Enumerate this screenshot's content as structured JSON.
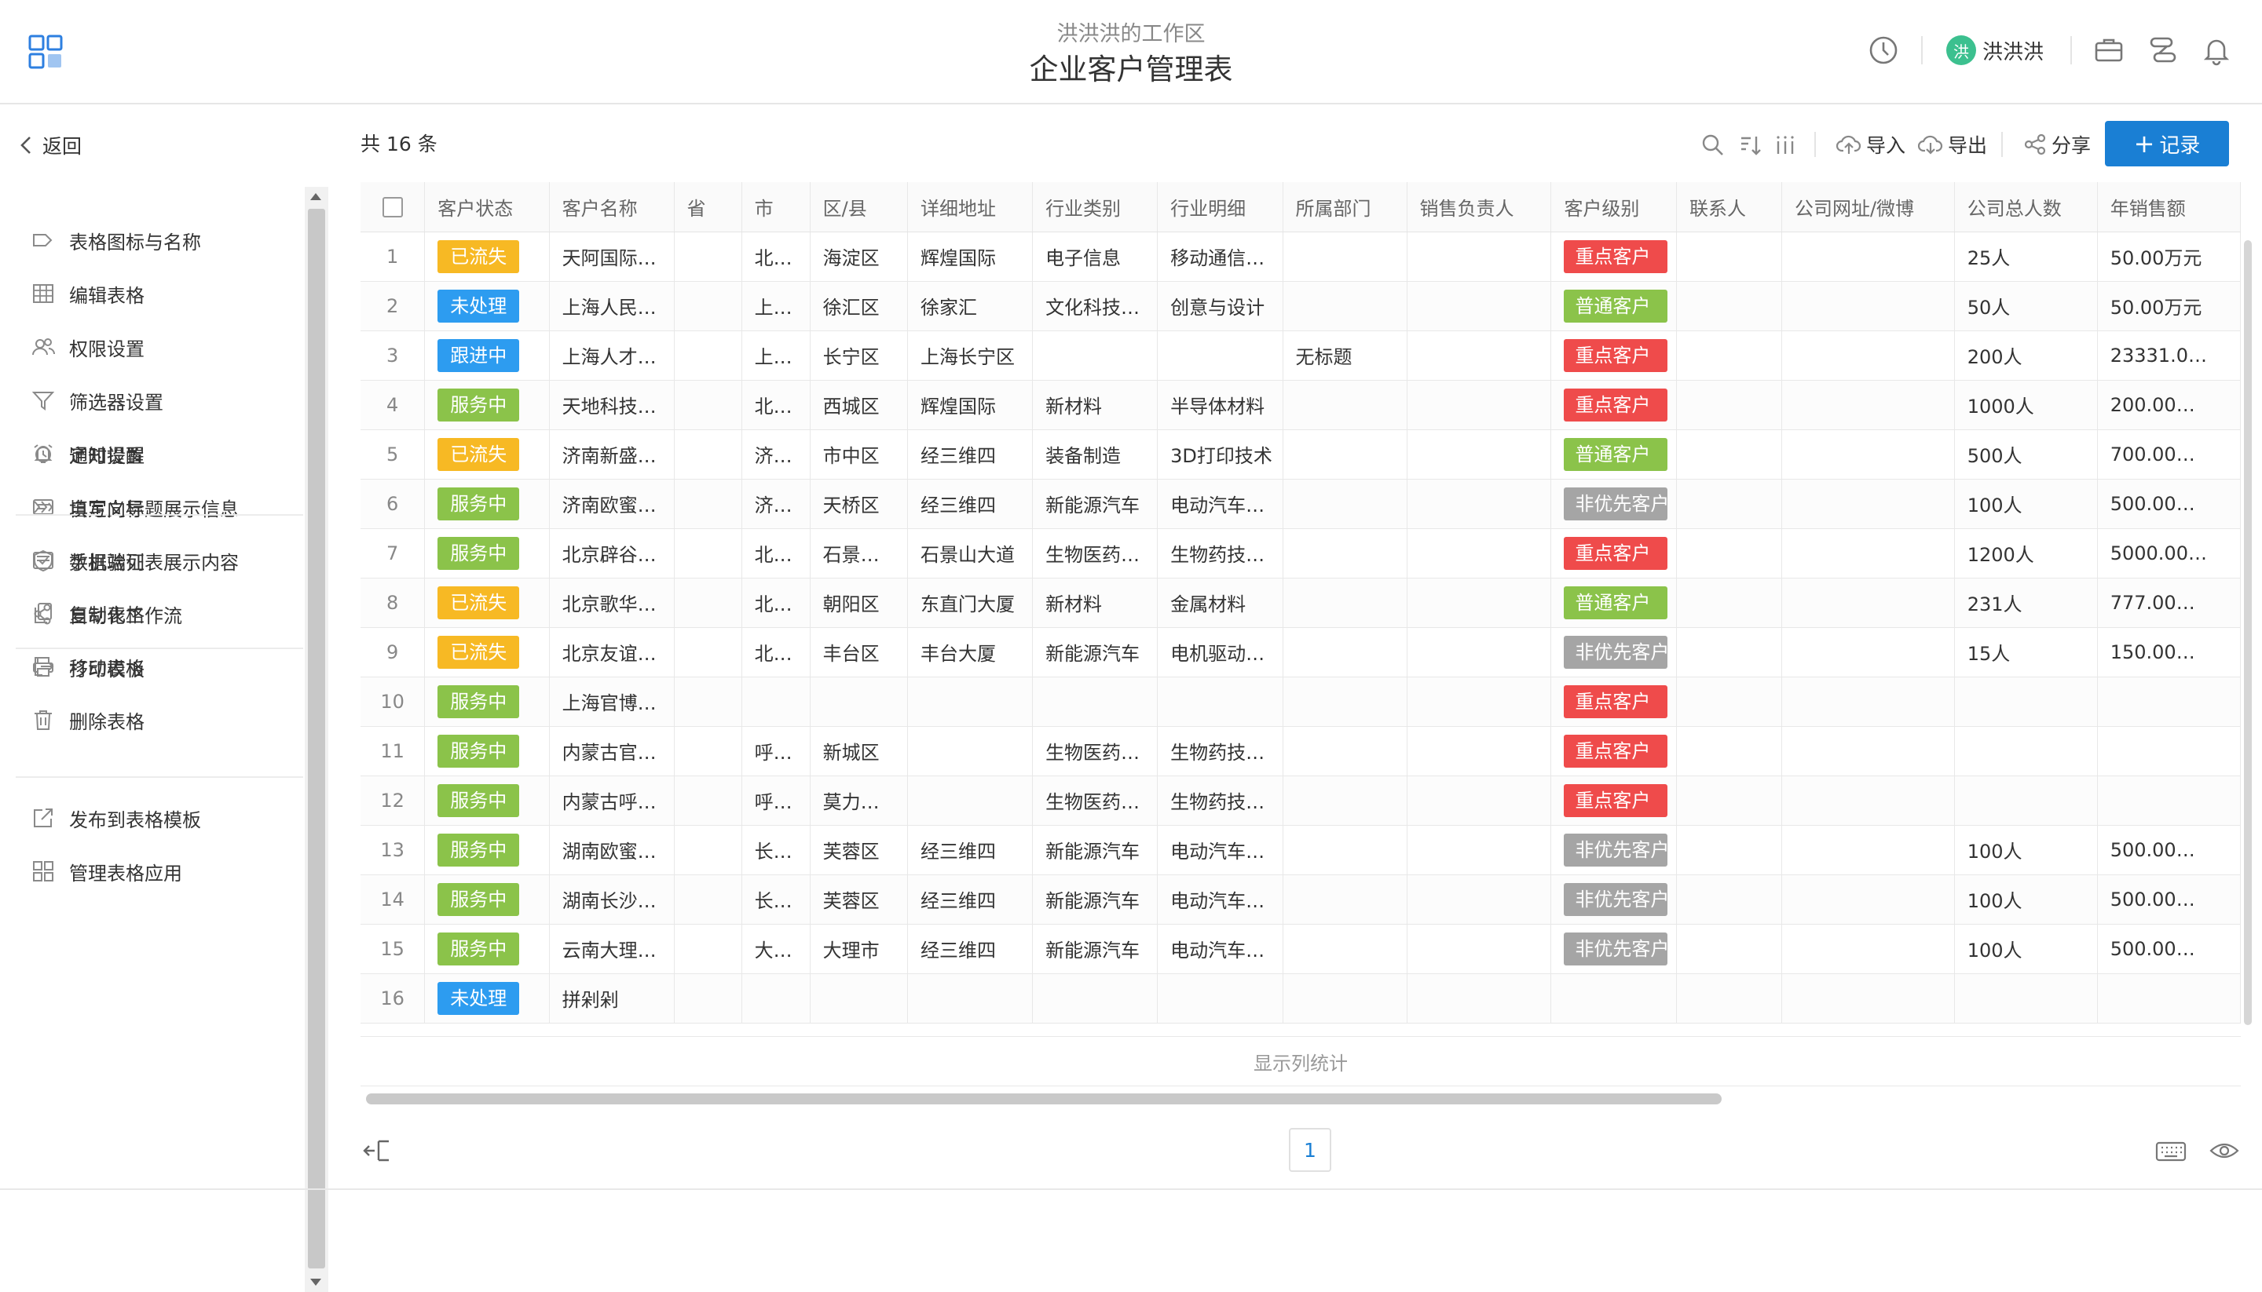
{
  "header": {
    "workspace": "洪洪洪的工作区",
    "title": "企业客户管理表",
    "user_avatar_char": "洪",
    "user_name": "洪洪洪"
  },
  "sidebar": {
    "back_label": "返回",
    "groups": [
      [
        {
          "label": "表格图标与名称",
          "icon": "tag-icon"
        },
        {
          "label": "编辑表格",
          "icon": "table-icon"
        },
        {
          "label": "权限设置",
          "icon": "users-icon"
        },
        {
          "label": "筛选器设置",
          "icon": "filter-icon"
        },
        {
          "label": "通知设置",
          "icon": "bell-icon"
        },
        {
          "label": "自定义标题展示信息",
          "icon": "title-card-icon"
        },
        {
          "label": "手机端列表展示内容",
          "icon": "mobile-list-icon"
        }
      ],
      [
        {
          "label": "定时提醒",
          "icon": "alarm-icon"
        },
        {
          "label": "填写向导",
          "icon": "guide-icon"
        },
        {
          "label": "数据验证",
          "icon": "shield-check-icon"
        },
        {
          "label": "自动化工作流",
          "icon": "workflow-icon"
        },
        {
          "label": "打印模板",
          "icon": "printer-icon"
        }
      ],
      [
        {
          "label": "复制表格",
          "icon": "copy-icon"
        },
        {
          "label": "移动表格",
          "icon": "move-icon"
        },
        {
          "label": "删除表格",
          "icon": "trash-icon"
        }
      ],
      [
        {
          "label": "发布到表格模板",
          "icon": "publish-icon"
        },
        {
          "label": "管理表格应用",
          "icon": "apps-icon"
        }
      ]
    ]
  },
  "toolbar": {
    "record_count": "共 16 条",
    "import_label": "导入",
    "export_label": "导出",
    "share_label": "分享",
    "add_label": "记录"
  },
  "table": {
    "columns": [
      "客户状态",
      "客户名称",
      "省",
      "市",
      "区/县",
      "详细地址",
      "行业类别",
      "行业明细",
      "所属部门",
      "销售负责人",
      "客户级别",
      "联系人",
      "公司网址/微博",
      "公司总人数",
      "年销售额"
    ],
    "rows": [
      {
        "n": "1",
        "status": "已流失",
        "name": "天阿国际…",
        "prov": "",
        "city": "北…",
        "dist": "海淀区",
        "addr": "辉煌国际",
        "ind": "电子信息",
        "detail": "移动通信…",
        "dept": "",
        "sales": "",
        "level": "重点客户",
        "contact": "",
        "web": "",
        "staff": "25人",
        "revenue": "50.00万元"
      },
      {
        "n": "2",
        "status": "未处理",
        "name": "上海人民…",
        "prov": "",
        "city": "上…",
        "dist": "徐汇区",
        "addr": "徐家汇",
        "ind": "文化科技…",
        "detail": "创意与设计",
        "dept": "",
        "sales": "",
        "level": "普通客户",
        "contact": "",
        "web": "",
        "staff": "50人",
        "revenue": "50.00万元"
      },
      {
        "n": "3",
        "status": "跟进中",
        "name": "上海人才…",
        "prov": "",
        "city": "上…",
        "dist": "长宁区",
        "addr": "上海长宁区",
        "ind": "",
        "detail": "",
        "dept": "无标题",
        "sales": "",
        "level": "重点客户",
        "contact": "",
        "web": "",
        "staff": "200人",
        "revenue": "23331.0…"
      },
      {
        "n": "4",
        "status": "服务中",
        "name": "天地科技…",
        "prov": "",
        "city": "北…",
        "dist": "西城区",
        "addr": "辉煌国际",
        "ind": "新材料",
        "detail": "半导体材料",
        "dept": "",
        "sales": "",
        "level": "重点客户",
        "contact": "",
        "web": "",
        "staff": "1000人",
        "revenue": "200.00…"
      },
      {
        "n": "5",
        "status": "已流失",
        "name": "济南新盛…",
        "prov": "",
        "city": "济…",
        "dist": "市中区",
        "addr": "经三维四",
        "ind": "装备制造",
        "detail": "3D打印技术",
        "dept": "",
        "sales": "",
        "level": "普通客户",
        "contact": "",
        "web": "",
        "staff": "500人",
        "revenue": "700.00…"
      },
      {
        "n": "6",
        "status": "服务中",
        "name": "济南欧蜜…",
        "prov": "",
        "city": "济…",
        "dist": "天桥区",
        "addr": "经三维四",
        "ind": "新能源汽车",
        "detail": "电动汽车…",
        "dept": "",
        "sales": "",
        "level": "非优先客户",
        "contact": "",
        "web": "",
        "staff": "100人",
        "revenue": "500.00…"
      },
      {
        "n": "7",
        "status": "服务中",
        "name": "北京辟谷…",
        "prov": "",
        "city": "北…",
        "dist": "石景…",
        "addr": "石景山大道",
        "ind": "生物医药…",
        "detail": "生物药技…",
        "dept": "",
        "sales": "",
        "level": "重点客户",
        "contact": "",
        "web": "",
        "staff": "1200人",
        "revenue": "5000.00…"
      },
      {
        "n": "8",
        "status": "已流失",
        "name": "北京歌华…",
        "prov": "",
        "city": "北…",
        "dist": "朝阳区",
        "addr": "东直门大厦",
        "ind": "新材料",
        "detail": "金属材料",
        "dept": "",
        "sales": "",
        "level": "普通客户",
        "contact": "",
        "web": "",
        "staff": "231人",
        "revenue": "777.00…"
      },
      {
        "n": "9",
        "status": "已流失",
        "name": "北京友谊…",
        "prov": "",
        "city": "北…",
        "dist": "丰台区",
        "addr": "丰台大厦",
        "ind": "新能源汽车",
        "detail": "电机驱动…",
        "dept": "",
        "sales": "",
        "level": "非优先客户",
        "contact": "",
        "web": "",
        "staff": "15人",
        "revenue": "150.00…"
      },
      {
        "n": "10",
        "status": "服务中",
        "name": "上海官博…",
        "prov": "",
        "city": "",
        "dist": "",
        "addr": "",
        "ind": "",
        "detail": "",
        "dept": "",
        "sales": "",
        "level": "重点客户",
        "contact": "",
        "web": "",
        "staff": "",
        "revenue": ""
      },
      {
        "n": "11",
        "status": "服务中",
        "name": "内蒙古官…",
        "prov": "",
        "city": "呼…",
        "dist": "新城区",
        "addr": "",
        "ind": "生物医药…",
        "detail": "生物药技…",
        "dept": "",
        "sales": "",
        "level": "重点客户",
        "contact": "",
        "web": "",
        "staff": "",
        "revenue": ""
      },
      {
        "n": "12",
        "status": "服务中",
        "name": "内蒙古呼…",
        "prov": "",
        "city": "呼…",
        "dist": "莫力…",
        "addr": "",
        "ind": "生物医药…",
        "detail": "生物药技…",
        "dept": "",
        "sales": "",
        "level": "重点客户",
        "contact": "",
        "web": "",
        "staff": "",
        "revenue": ""
      },
      {
        "n": "13",
        "status": "服务中",
        "name": "湖南欧蜜…",
        "prov": "",
        "city": "长…",
        "dist": "芙蓉区",
        "addr": "经三维四",
        "ind": "新能源汽车",
        "detail": "电动汽车…",
        "dept": "",
        "sales": "",
        "level": "非优先客户",
        "contact": "",
        "web": "",
        "staff": "100人",
        "revenue": "500.00…"
      },
      {
        "n": "14",
        "status": "服务中",
        "name": "湖南长沙…",
        "prov": "",
        "city": "长…",
        "dist": "芙蓉区",
        "addr": "经三维四",
        "ind": "新能源汽车",
        "detail": "电动汽车…",
        "dept": "",
        "sales": "",
        "level": "非优先客户",
        "contact": "",
        "web": "",
        "staff": "100人",
        "revenue": "500.00…"
      },
      {
        "n": "15",
        "status": "服务中",
        "name": "云南大理…",
        "prov": "",
        "city": "大…",
        "dist": "大理市",
        "addr": "经三维四",
        "ind": "新能源汽车",
        "detail": "电动汽车…",
        "dept": "",
        "sales": "",
        "level": "非优先客户",
        "contact": "",
        "web": "",
        "staff": "100人",
        "revenue": "500.00…"
      },
      {
        "n": "16",
        "status": "未处理",
        "name": "拼剁剁",
        "prov": "",
        "city": "",
        "dist": "",
        "addr": "",
        "ind": "",
        "detail": "",
        "dept": "",
        "sales": "",
        "level": "",
        "contact": "",
        "web": "",
        "staff": "",
        "revenue": ""
      }
    ],
    "status_colors": {
      "已流失": "#f7b924",
      "未处理": "#2d9cf0",
      "跟进中": "#2d9cf0",
      "服务中": "#8bc34a"
    },
    "level_colors": {
      "重点客户": "#ef4b4b",
      "普通客户": "#8bc34a",
      "非优先客户": "#a5a5a5"
    },
    "stats_label": "显示列统计"
  },
  "pagination": {
    "current_page": "1"
  }
}
